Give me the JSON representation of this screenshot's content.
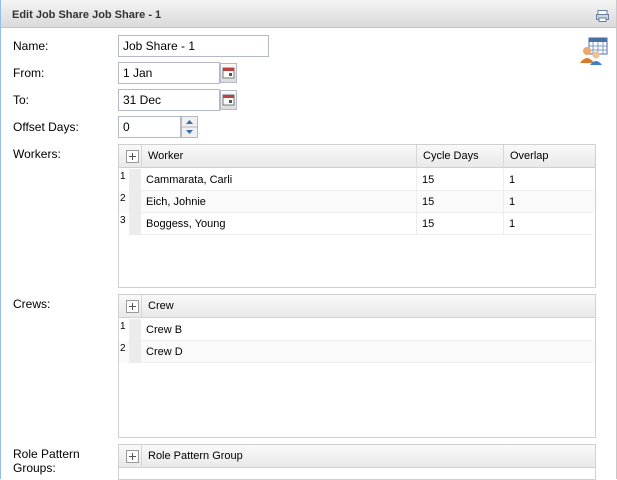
{
  "window": {
    "title": "Edit Job Share Job Share - 1"
  },
  "form": {
    "name_label": "Name:",
    "name_value": "Job Share - 1",
    "from_label": "From:",
    "from_value": "1 Jan",
    "to_label": "To:",
    "to_value": "31 Dec",
    "offset_label": "Offset Days:",
    "offset_value": "0",
    "workers_label": "Workers:",
    "crews_label": "Crews:",
    "role_label": "Role Pattern Groups:"
  },
  "workers": {
    "columns": [
      "Worker",
      "Cycle Days",
      "Overlap"
    ],
    "rows": [
      {
        "n": "1",
        "worker": "Cammarata, Carli",
        "cycle": "15",
        "overlap": "1"
      },
      {
        "n": "2",
        "worker": "Eich, Johnie",
        "cycle": "15",
        "overlap": "1"
      },
      {
        "n": "3",
        "worker": "Boggess, Young",
        "cycle": "15",
        "overlap": "1"
      }
    ]
  },
  "crews": {
    "columns": [
      "Crew"
    ],
    "rows": [
      {
        "n": "1",
        "crew": "Crew B"
      },
      {
        "n": "2",
        "crew": "Crew D"
      }
    ]
  },
  "roles": {
    "columns": [
      "Role Pattern Group"
    ]
  },
  "icons": {
    "header_tool": "print-icon",
    "calendar": "calendar-icon",
    "avatar": "people-calendar-icon",
    "add": "plus-icon"
  }
}
